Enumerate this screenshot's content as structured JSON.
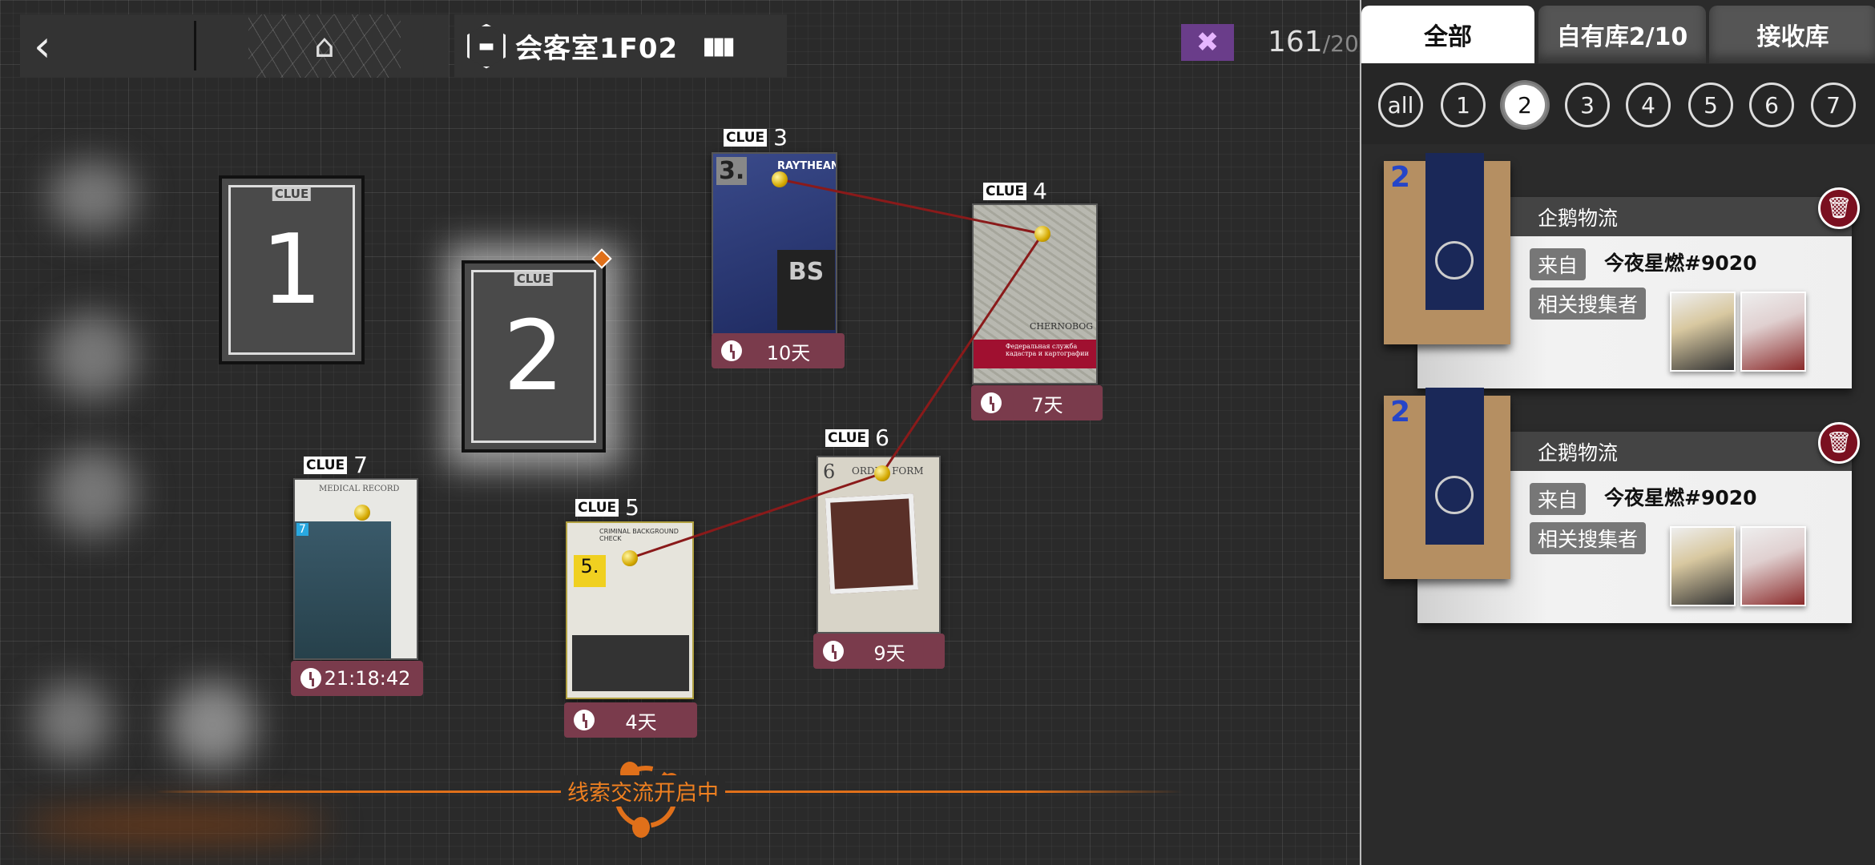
{
  "topbar": {
    "back_icon": "chevron-left-icon",
    "home_icon": "home-icon",
    "room_icon": "sofa-icon",
    "room_name": "会客室1F02",
    "level_icon": "bars-icon",
    "drone_icon": "drone-icon",
    "drone_count": "161",
    "drone_max": "/20"
  },
  "clues": [
    {
      "label": "CLUE",
      "number": "1"
    },
    {
      "label": "CLUE",
      "number": "2"
    },
    {
      "label": "CLUE",
      "number": "3",
      "timer": "10天",
      "doc_text": [
        "3.",
        "RAYTHEAN",
        "BS"
      ]
    },
    {
      "label": "CLUE",
      "number": "4",
      "timer": "7天",
      "doc_text": [
        "CHERNOBOG",
        "Федеральная служба кадастра и картографии"
      ]
    },
    {
      "label": "CLUE",
      "number": "5",
      "timer": "4天",
      "doc_text": [
        "CRIMINAL BACKGROUND CHECK",
        "5."
      ]
    },
    {
      "label": "CLUE",
      "number": "6",
      "timer": "9天",
      "doc_text": [
        "6",
        "ORDER FORM"
      ]
    },
    {
      "label": "CLUE",
      "number": "7",
      "timer": "21:18:42",
      "doc_text": [
        "MEDICAL RECORD",
        "7"
      ]
    }
  ],
  "status": {
    "text": "线索交流开启中"
  },
  "panel": {
    "tabs": [
      "全部",
      "自有库2/10",
      "接收库"
    ],
    "active_tab": 0,
    "filters": [
      "all",
      "1",
      "2",
      "3",
      "4",
      "5",
      "6",
      "7"
    ],
    "active_filter": "2",
    "cards": [
      {
        "clue_number": "2",
        "source": "企鹅物流",
        "from_label": "来自",
        "from": "今夜星燃#9020",
        "collectors_label": "相关搜集者"
      },
      {
        "clue_number": "2",
        "source": "企鹅物流",
        "from_label": "来自",
        "from": "今夜星燃#9020",
        "collectors_label": "相关搜集者"
      }
    ]
  },
  "colors": {
    "timer": "#7a3b4c",
    "accent": "#e0701a",
    "trash": "#7a1020",
    "string": "#8a1a1a"
  }
}
